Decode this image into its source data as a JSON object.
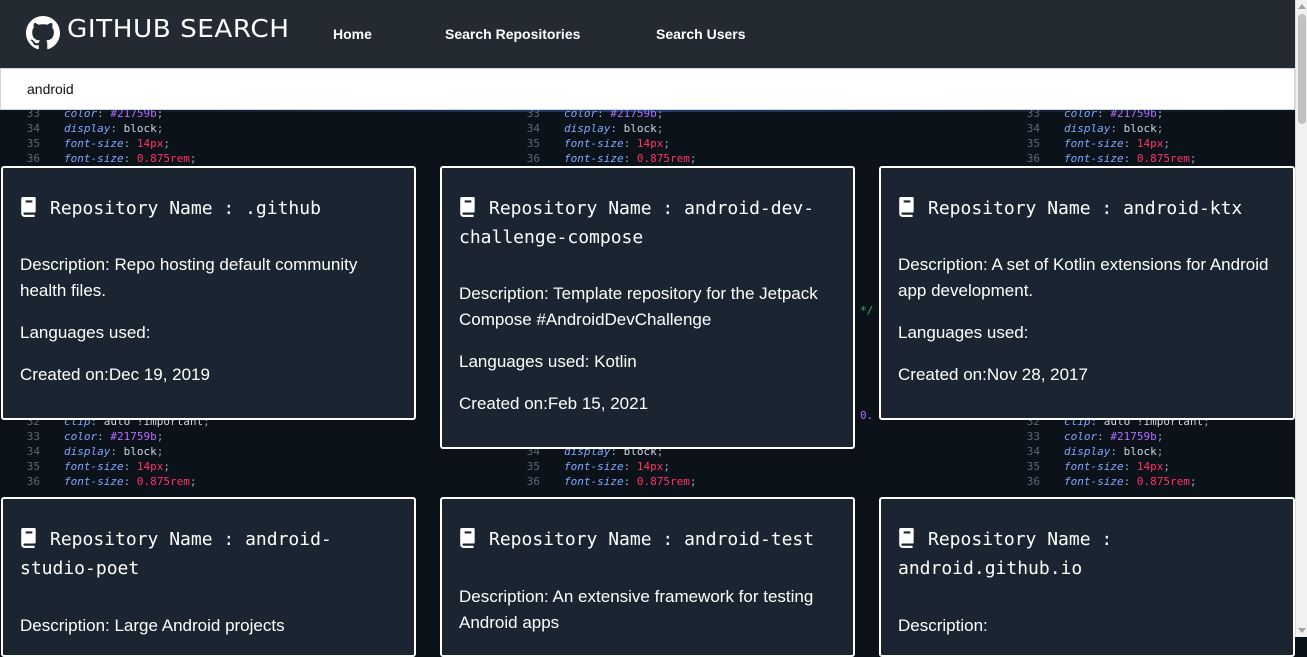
{
  "app": {
    "brand": "GITHUB SEARCH",
    "logo_icon": "github-octocat-icon"
  },
  "nav": {
    "items": [
      "Home",
      "Search Repositories",
      "Search Users"
    ]
  },
  "search": {
    "value": "android"
  },
  "cards": [
    {
      "title": "Repository Name : .github",
      "description": "Description: Repo hosting default community health files.",
      "languages": "Languages used:",
      "created": "Created on:Dec 19, 2019"
    },
    {
      "title": "Repository Name : android-dev-challenge-compose",
      "description": "Description: Template repository for the Jetpack Compose #AndroidDevChallenge",
      "languages": "Languages used: Kotlin",
      "created": "Created on:Feb 15, 2021"
    },
    {
      "title": "Repository Name : android-ktx",
      "description": "Description: A set of Kotlin extensions for Android app development.",
      "languages": "Languages used:",
      "created": "Created on:Nov 28, 2017"
    },
    {
      "title": "Repository Name : android-studio-poet",
      "description": "Description: Large Android projects",
      "languages": "",
      "created": ""
    },
    {
      "title": "Repository Name : android-test",
      "description": "Description: An extensive framework for testing Android apps",
      "languages": "",
      "created": ""
    },
    {
      "title": "Repository Name : android.github.io",
      "description": "Description:",
      "languages": "",
      "created": ""
    }
  ],
  "background_code": {
    "top_lines": [
      {
        "n": "33",
        "prop": "color",
        "val": "#21759b"
      },
      {
        "n": "34",
        "prop": "display",
        "val": "block"
      },
      {
        "n": "35",
        "prop": "font-size",
        "val": "14px"
      },
      {
        "n": "36",
        "prop": "font-size",
        "val": "0.875rem"
      }
    ],
    "bottom_lines": [
      {
        "n": "32",
        "prop": "clip",
        "val": "auto !important"
      },
      {
        "n": "33",
        "prop": "color",
        "val": "#21759b"
      },
      {
        "n": "34",
        "prop": "display",
        "val": "block"
      },
      {
        "n": "35",
        "prop": "font-size",
        "val": "14px"
      },
      {
        "n": "36",
        "prop": "font-size",
        "val": "0.875rem"
      }
    ],
    "fragments": [
      "*/",
      "0."
    ]
  },
  "colors": {
    "navbar": "#232a31",
    "card_bg": "#1a2531",
    "card_border": "#ffffff",
    "page_bg": "#0b1219"
  }
}
